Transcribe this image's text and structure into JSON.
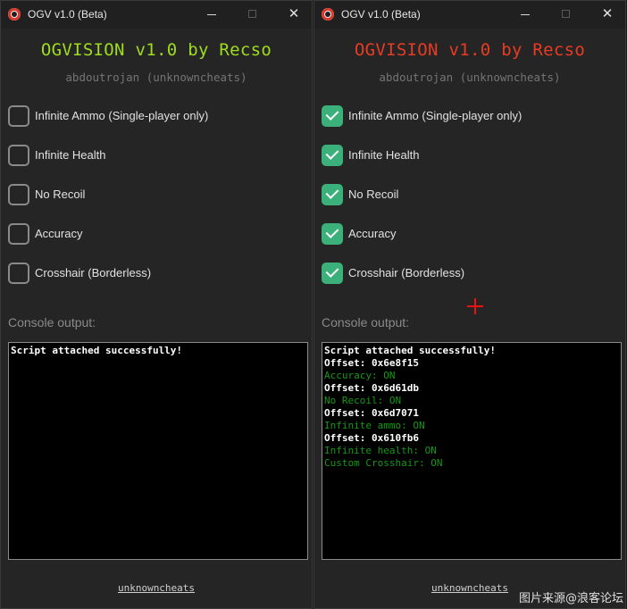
{
  "left": {
    "window_title": "OGV v1.0 (Beta)",
    "heading": "OGVISION v1.0 by Recso",
    "heading_color": "#9fdc1e",
    "subtitle": "abdoutrojan (unknowncheats)",
    "options": [
      {
        "label": "Infinite Ammo (Single-player only)",
        "checked": false
      },
      {
        "label": "Infinite Health",
        "checked": false
      },
      {
        "label": "No Recoil",
        "checked": false
      },
      {
        "label": "Accuracy",
        "checked": false
      },
      {
        "label": "Crosshair (Borderless)",
        "checked": false
      }
    ],
    "console_label": "Console output:",
    "console_lines": [
      {
        "text": "Script attached successfully!",
        "color": "white"
      }
    ],
    "footer_link": "unknowncheats"
  },
  "right": {
    "window_title": "OGV v1.0 (Beta)",
    "heading": "OGVISION v1.0 by Recso",
    "heading_color": "#e83b23",
    "subtitle": "abdoutrojan (unknowncheats)",
    "options": [
      {
        "label": "Infinite Ammo (Single-player only)",
        "checked": true
      },
      {
        "label": "Infinite Health",
        "checked": true
      },
      {
        "label": "No Recoil",
        "checked": true
      },
      {
        "label": "Accuracy",
        "checked": true
      },
      {
        "label": "Crosshair (Borderless)",
        "checked": true
      }
    ],
    "console_label": "Console output:",
    "console_lines": [
      {
        "text": "Script attached successfully!",
        "color": "white"
      },
      {
        "text": "Offset: 0x6e8f15",
        "color": "white"
      },
      {
        "text": "Accuracy: ON",
        "color": "green"
      },
      {
        "text": "Offset: 0x6d61db",
        "color": "white"
      },
      {
        "text": "No Recoil: ON",
        "color": "green"
      },
      {
        "text": "Offset: 0x6d7071",
        "color": "white"
      },
      {
        "text": "Infinite ammo: ON",
        "color": "green"
      },
      {
        "text": "Offset: 0x610fb6",
        "color": "white"
      },
      {
        "text": "Infinite health: ON",
        "color": "green"
      },
      {
        "text": "Custom Crosshair: ON",
        "color": "green"
      }
    ],
    "footer_link": "unknowncheats",
    "crosshair_color": "#ee1111"
  },
  "watermark": "图片来源@浪客论坛",
  "icons": {
    "app": "app-logo-icon",
    "minimize": "minimize-icon",
    "maximize": "maximize-icon",
    "close": "close-icon",
    "check": "check-icon"
  }
}
